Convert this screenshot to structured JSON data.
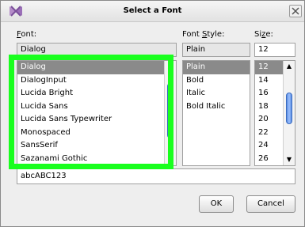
{
  "window": {
    "title": "Select a Font"
  },
  "labels": {
    "font_prefix": "",
    "font_mn": "F",
    "font_rest": "ont:",
    "style_pre": "Font ",
    "style_mn": "S",
    "style_rest": "tyle:",
    "size_pre": "Si",
    "size_mn": "z",
    "size_rest": "e:"
  },
  "font_field": {
    "value": "Dialog"
  },
  "style_field": {
    "value": "Plain"
  },
  "size_field": {
    "value": "12"
  },
  "font_list": {
    "items": [
      "Dialog",
      "DialogInput",
      "Lucida Bright",
      "Lucida Sans",
      "Lucida Sans Typewriter",
      "Monospaced",
      "SansSerif",
      "Sazanami Gothic"
    ],
    "selected": "Dialog"
  },
  "style_list": {
    "items": [
      "Plain",
      "Bold",
      "Italic",
      "Bold Italic"
    ],
    "selected": "Plain"
  },
  "size_list": {
    "items": [
      "12",
      "14",
      "16",
      "18",
      "20",
      "22",
      "24",
      "26"
    ],
    "selected": "12"
  },
  "preview": {
    "text": "abcABC123"
  },
  "buttons": {
    "ok": "OK",
    "cancel": "Cancel"
  },
  "colors": {
    "highlight": "#19ff1e",
    "selection": "#8a8a8a"
  }
}
